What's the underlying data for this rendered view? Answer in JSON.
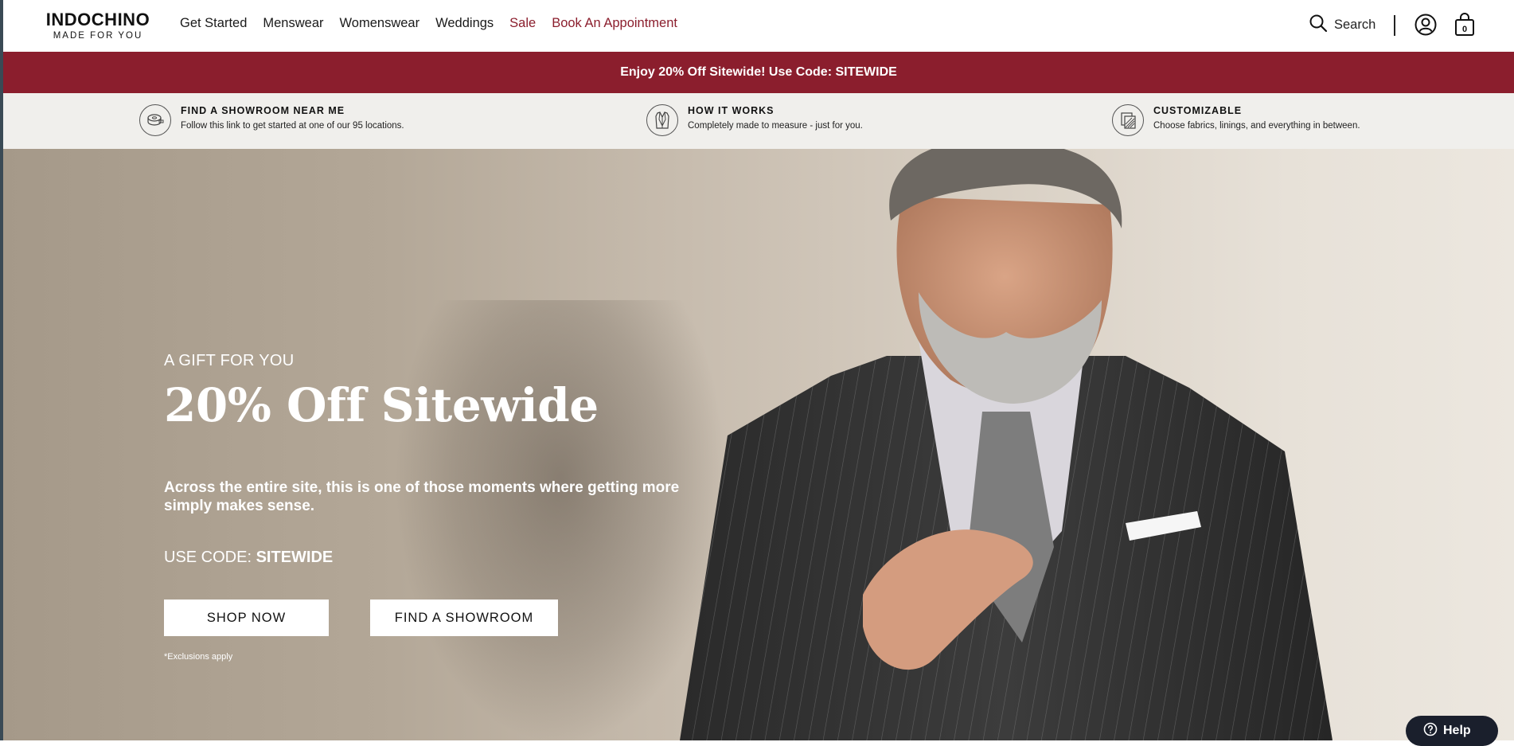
{
  "header": {
    "logo_main": "INDOCHINO",
    "logo_sub": "MADE FOR YOU",
    "nav": [
      {
        "label": "Get Started"
      },
      {
        "label": "Menswear"
      },
      {
        "label": "Womenswear"
      },
      {
        "label": "Weddings"
      },
      {
        "label": "Sale"
      },
      {
        "label": "Book An Appointment"
      }
    ],
    "search_label": "Search",
    "bag_count": "0"
  },
  "promo": {
    "text": "Enjoy 20% Off Sitewide! Use Code: SITEWIDE"
  },
  "features": [
    {
      "icon": "tape-measure-icon",
      "title": "FIND A SHOWROOM NEAR ME",
      "desc": "Follow this link to get started at one of our 95 locations."
    },
    {
      "icon": "suit-jacket-icon",
      "title": "HOW IT WORKS",
      "desc": "Completely made to measure - just for you."
    },
    {
      "icon": "fabric-swatch-icon",
      "title": "CUSTOMIZABLE",
      "desc": "Choose fabrics, linings, and everything in between."
    }
  ],
  "hero": {
    "eyebrow": "A GIFT FOR YOU",
    "title": "20% Off Sitewide",
    "description": "Across the entire site, this is one of those moments where getting more simply makes sense.",
    "code_prefix": "USE CODE: ",
    "code": "SITEWIDE",
    "shop_button": "SHOP NOW",
    "showroom_button": "FIND A SHOWROOM",
    "exclusions": "*Exclusions apply"
  },
  "help": {
    "label": "Help"
  },
  "colors": {
    "brand_red": "#8b1e2d",
    "help_bg": "#1a1f2c",
    "feature_bg": "#f0efec"
  }
}
